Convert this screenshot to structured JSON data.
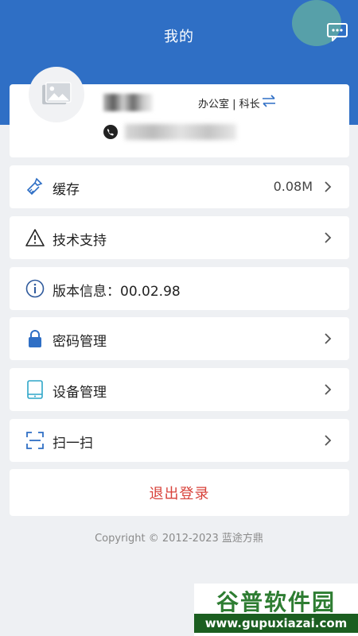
{
  "header": {
    "title": "我的"
  },
  "profile": {
    "dept_title": "办公室 | 科长"
  },
  "menu": [
    {
      "label": "缓存",
      "value": "0.08M",
      "icon": "broom-icon"
    },
    {
      "label": "技术支持",
      "value": "",
      "icon": "warning-icon"
    },
    {
      "label": "版本信息：00.02.98",
      "value": "",
      "icon": "info-icon"
    },
    {
      "label": "密码管理",
      "value": "",
      "icon": "lock-icon"
    },
    {
      "label": "设备管理",
      "value": "",
      "icon": "tablet-icon"
    },
    {
      "label": "扫一扫",
      "value": "",
      "icon": "scan-icon"
    }
  ],
  "logout_label": "退出登录",
  "copyright": "Copyright © 2012-2023 蓝途方鼎",
  "watermark": {
    "top": "谷普软件园",
    "bottom": "www.gupuxiazai.com"
  },
  "colors": {
    "header": "#2f6fc5",
    "accent": "#2f6fc5",
    "logout": "#d8423a",
    "background": "#eef0f3"
  }
}
